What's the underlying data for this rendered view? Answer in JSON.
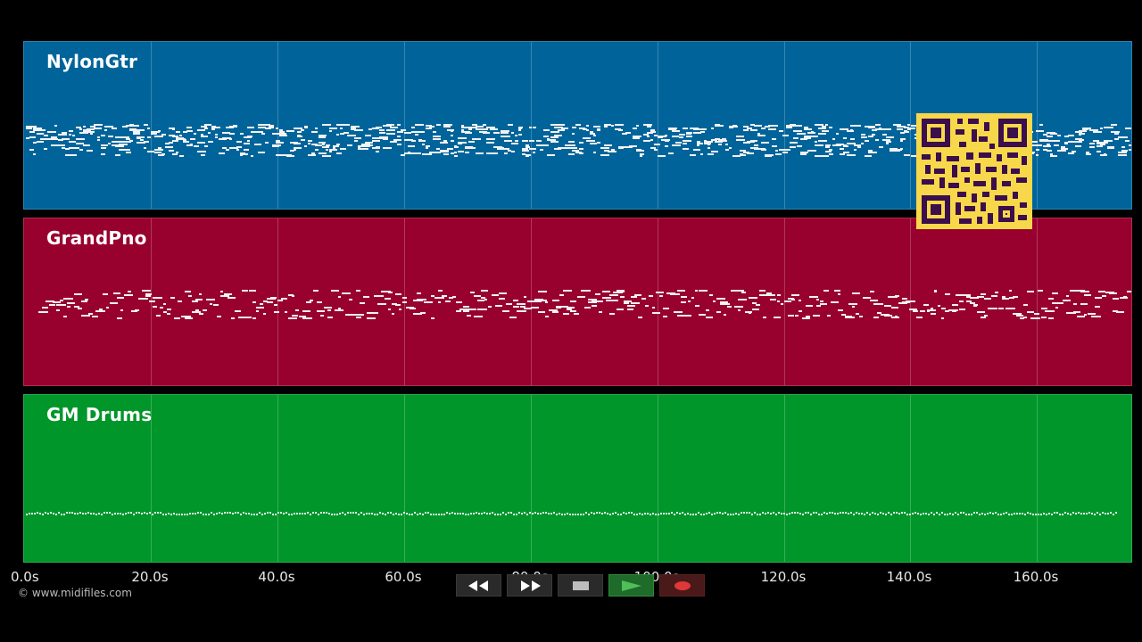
{
  "tracks": [
    {
      "id": "nylon",
      "name": "NylonGtr",
      "color": "#00649b"
    },
    {
      "id": "piano",
      "name": "GrandPno",
      "color": "#98002e"
    },
    {
      "id": "drums",
      "name": "GM Drums",
      "color": "#00962a"
    }
  ],
  "timeline": {
    "labels": [
      "0.0s",
      "20.0s",
      "40.0s",
      "60.0s",
      "80.0s",
      "100.0s",
      "120.0s",
      "140.0s",
      "160.0s"
    ]
  },
  "footer": {
    "copyright": "© www.midifiles.com"
  },
  "transport": {
    "buttons": [
      {
        "name": "rewind-button",
        "icon": "rewind-icon"
      },
      {
        "name": "fast-forward-button",
        "icon": "fast-forward-icon"
      },
      {
        "name": "stop-button",
        "icon": "stop-icon"
      },
      {
        "name": "play-button",
        "icon": "play-icon"
      },
      {
        "name": "record-button",
        "icon": "record-icon"
      }
    ]
  },
  "qr": {
    "name": "qr-code",
    "color": "#f7d84a",
    "dark": "#3b0e4c"
  }
}
